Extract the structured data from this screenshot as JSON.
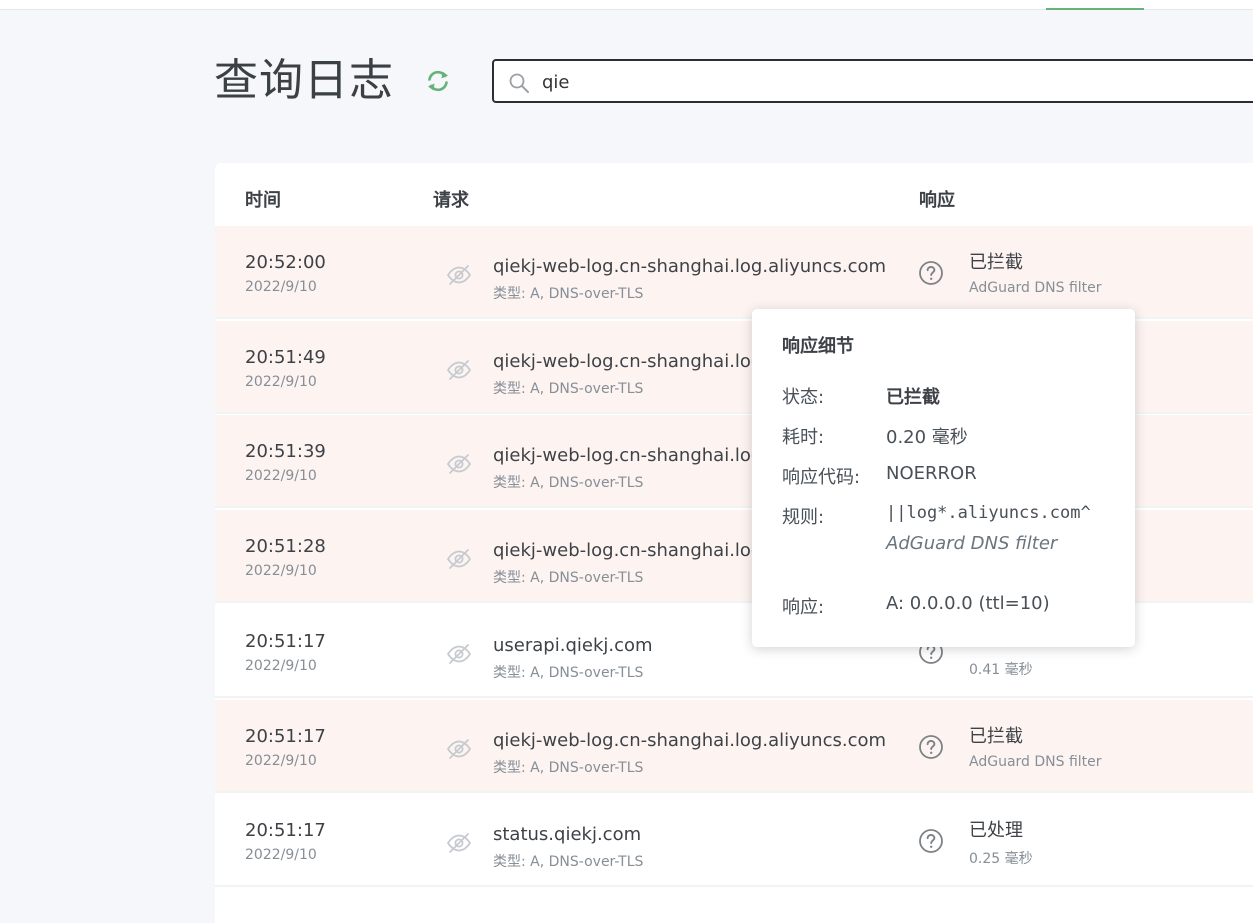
{
  "page": {
    "title": "查询日志"
  },
  "search": {
    "value": "qie"
  },
  "table": {
    "columns": [
      "时间",
      "请求",
      "响应"
    ],
    "rows": [
      {
        "time": "20:52:00",
        "date": "2022/9/10",
        "domain": "qiekj-web-log.cn-shanghai.log.aliyuncs.com",
        "type": "类型: A, DNS-over-TLS",
        "status": "已拦截",
        "sub": "AdGuard DNS filter",
        "blocked": true
      },
      {
        "time": "20:51:49",
        "date": "2022/9/10",
        "domain": "qiekj-web-log.cn-shanghai.log.a",
        "type": "类型: A, DNS-over-TLS",
        "status": "",
        "sub": "",
        "blocked": true
      },
      {
        "time": "20:51:39",
        "date": "2022/9/10",
        "domain": "qiekj-web-log.cn-shanghai.log.a",
        "type": "类型: A, DNS-over-TLS",
        "status": "",
        "sub": "",
        "blocked": true
      },
      {
        "time": "20:51:28",
        "date": "2022/9/10",
        "domain": "qiekj-web-log.cn-shanghai.log.a",
        "type": "类型: A, DNS-over-TLS",
        "status": "",
        "sub": "",
        "blocked": true
      },
      {
        "time": "20:51:17",
        "date": "2022/9/10",
        "domain": "userapi.qiekj.com",
        "type": "类型: A, DNS-over-TLS",
        "status": "",
        "sub": "0.41 毫秒",
        "blocked": false
      },
      {
        "time": "20:51:17",
        "date": "2022/9/10",
        "domain": "qiekj-web-log.cn-shanghai.log.aliyuncs.com",
        "type": "类型: A, DNS-over-TLS",
        "status": "已拦截",
        "sub": "AdGuard DNS filter",
        "blocked": true
      },
      {
        "time": "20:51:17",
        "date": "2022/9/10",
        "domain": "status.qiekj.com",
        "type": "类型: A, DNS-over-TLS",
        "status": "已处理",
        "sub": "0.25 毫秒",
        "blocked": false
      }
    ]
  },
  "tooltip": {
    "title": "响应细节",
    "status_label": "状态:",
    "status_value": "已拦截",
    "elapsed_label": "耗时:",
    "elapsed_value": "0.20 毫秒",
    "code_label": "响应代码:",
    "code_value": "NOERROR",
    "rule_label": "规则:",
    "rule_value": "||log*.aliyuncs.com^",
    "rule_list": "AdGuard DNS filter",
    "answer_label": "响应:",
    "answer_value": "A: 0.0.0.0 (ttl=10)"
  },
  "colors": {
    "accent": "#67b279",
    "blocked_row": "#fdf4f2",
    "text": "#3e4247",
    "muted": "#868e96"
  },
  "icons": {
    "refresh": "refresh-icon",
    "search": "search-icon",
    "request_privacy": "eye-slash-icon",
    "response_help": "question-circle-icon"
  }
}
